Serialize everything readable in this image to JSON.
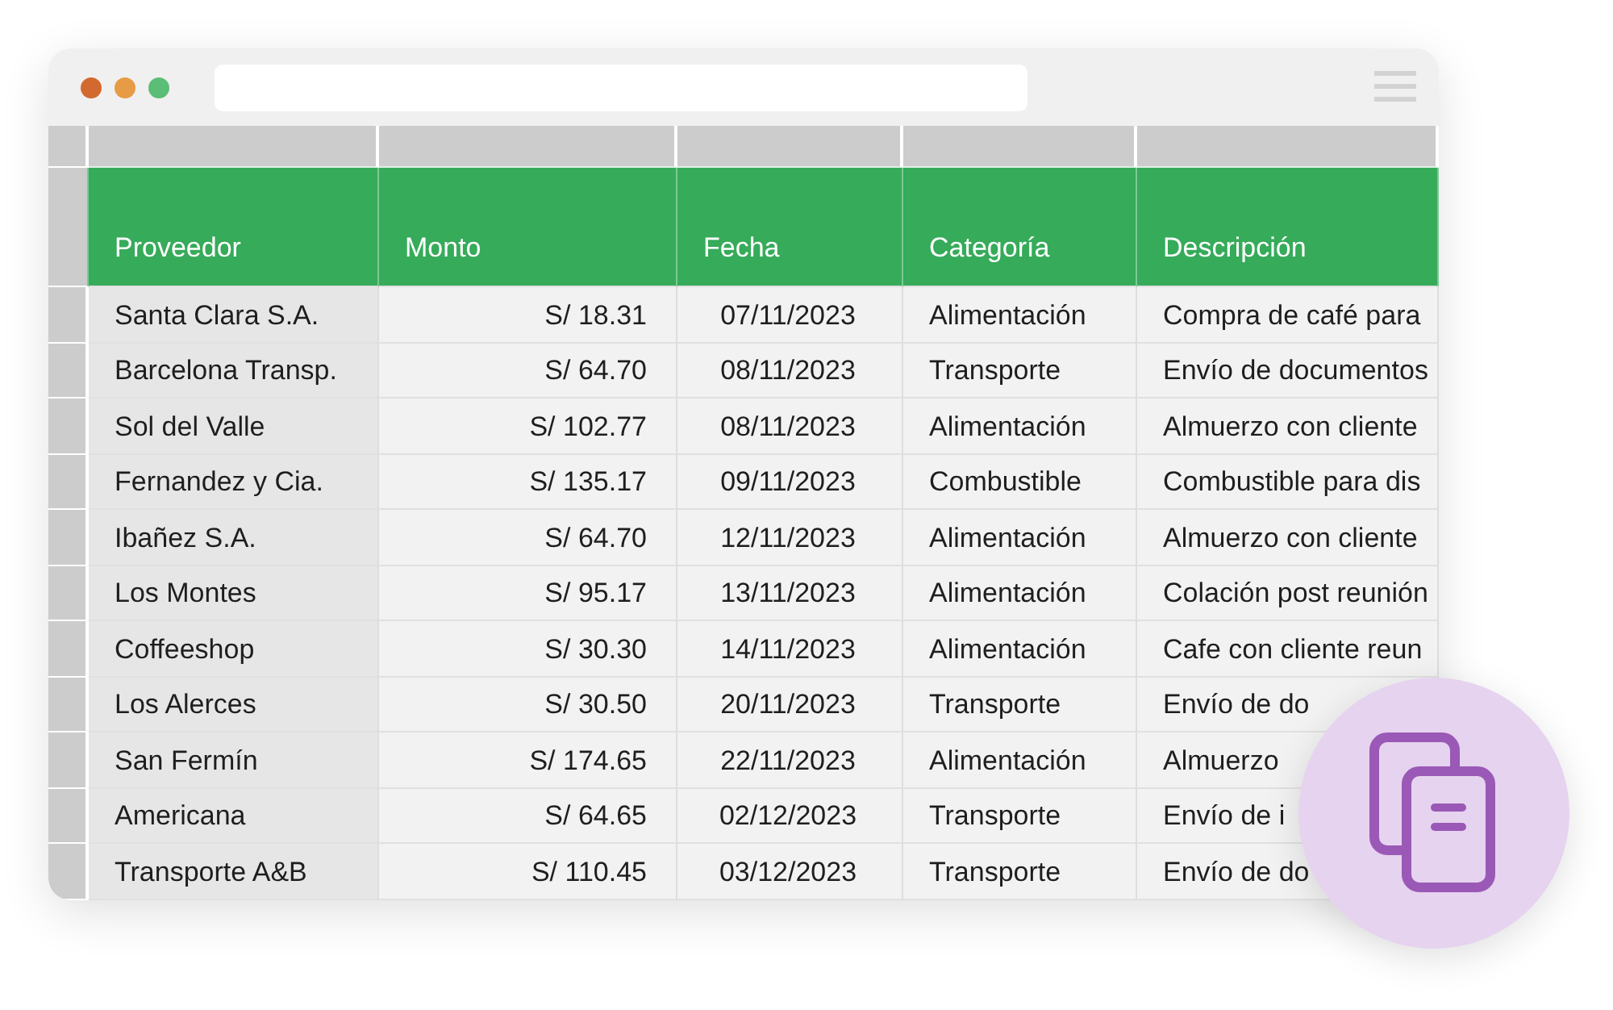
{
  "table": {
    "columns": [
      "Proveedor",
      "Monto",
      "Fecha",
      "Categoría",
      "Descripción"
    ],
    "rows": [
      [
        "Santa Clara S.A.",
        "S/ 18.31",
        "07/11/2023",
        "Alimentación",
        "Compra de café para"
      ],
      [
        "Barcelona Transp.",
        "S/ 64.70",
        "08/11/2023",
        "Transporte",
        "Envío de documentos"
      ],
      [
        "Sol del Valle",
        "S/ 102.77",
        "08/11/2023",
        "Alimentación",
        "Almuerzo con cliente"
      ],
      [
        "Fernandez y Cia.",
        "S/ 135.17",
        "09/11/2023",
        "Combustible",
        "Combustible para dis"
      ],
      [
        "Ibañez S.A.",
        "S/ 64.70",
        "12/11/2023",
        "Alimentación",
        "Almuerzo con cliente"
      ],
      [
        "Los Montes",
        "S/ 95.17",
        "13/11/2023",
        "Alimentación",
        "Colación post reunión"
      ],
      [
        "Coffeeshop",
        "S/ 30.30",
        "14/11/2023",
        "Alimentación",
        "Cafe con cliente reun"
      ],
      [
        "Los Alerces",
        "S/ 30.50",
        "20/11/2023",
        "Transporte",
        "Envío de do"
      ],
      [
        "San Fermín",
        "S/ 174.65",
        "22/11/2023",
        "Alimentación",
        "Almuerzo"
      ],
      [
        "Americana",
        "S/ 64.65",
        "02/12/2023",
        "Transporte",
        "Envío de i"
      ],
      [
        "Transporte A&B",
        "S/ 110.45",
        "03/12/2023",
        "Transporte",
        "Envío de do"
      ]
    ]
  }
}
